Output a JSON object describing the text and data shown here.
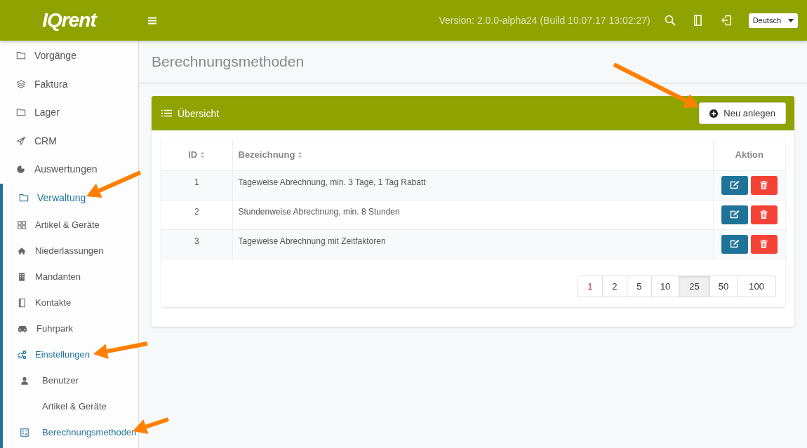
{
  "header": {
    "logo": "IQrent",
    "version": "Version: 2.0.0-alpha24 (Build 10.07.17 13:02:27)",
    "language": "Deutsch"
  },
  "sidebar": {
    "items": [
      {
        "label": "Vorgänge",
        "selected": false
      },
      {
        "label": "Faktura",
        "selected": false
      },
      {
        "label": "Lager",
        "selected": false
      },
      {
        "label": "CRM",
        "selected": false
      },
      {
        "label": "Auswertungen",
        "selected": false
      },
      {
        "label": "Verwaltung",
        "selected": true,
        "children": [
          {
            "label": "Artikel & Geräte",
            "selected": false
          },
          {
            "label": "Niederlassungen",
            "selected": false
          },
          {
            "label": "Mandanten",
            "selected": false
          },
          {
            "label": "Kontakte",
            "selected": false
          },
          {
            "label": "Fuhrpark",
            "selected": false
          },
          {
            "label": "Einstellungen",
            "selected": true,
            "children": [
              {
                "label": "Benutzer",
                "selected": false
              },
              {
                "label": "Artikel & Geräte",
                "selected": false
              },
              {
                "label": "Berechnungsmethoden",
                "selected": true
              }
            ]
          }
        ]
      }
    ]
  },
  "page": {
    "title": "Berechnungsmethoden"
  },
  "panel": {
    "title": "Übersicht",
    "new_button": "Neu anlegen"
  },
  "table": {
    "columns": [
      {
        "label": "ID",
        "sortable": true
      },
      {
        "label": "Bezeichnung",
        "sortable": true
      },
      {
        "label": "Aktion",
        "sortable": false
      }
    ],
    "rows": [
      {
        "id": "1",
        "name": "Tageweise Abrechnung, min. 3 Tage, 1 Tag Rabatt"
      },
      {
        "id": "2",
        "name": "Stundenweise Abrechnung, min. 8 Stunden"
      },
      {
        "id": "3",
        "name": "Tageweise Abrechnung mit Zeitfaktoren"
      }
    ]
  },
  "page_sizes": [
    {
      "label": "1",
      "selected": false
    },
    {
      "label": "2",
      "selected": false
    },
    {
      "label": "5",
      "selected": false
    },
    {
      "label": "10",
      "selected": false
    },
    {
      "label": "25",
      "selected": true
    },
    {
      "label": "50",
      "selected": false
    },
    {
      "label": "100",
      "selected": false
    }
  ]
}
